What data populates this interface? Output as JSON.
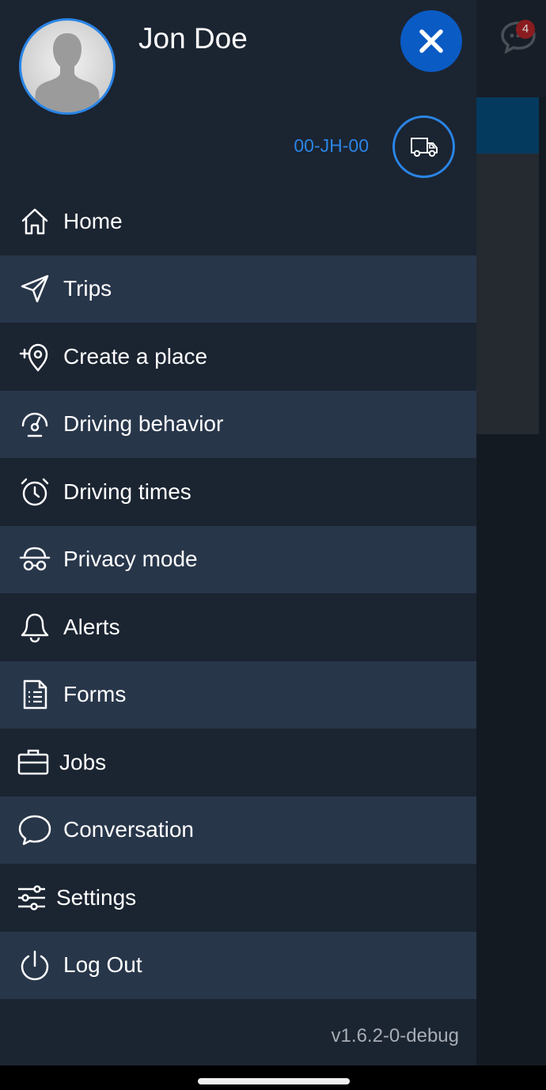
{
  "background": {
    "chat_badge_count": "4"
  },
  "profile": {
    "name": "Jon Doe",
    "vehicle_plate": "00-JH-00"
  },
  "menu": {
    "items": [
      {
        "label": "Home",
        "icon": "home-icon"
      },
      {
        "label": "Trips",
        "icon": "paper-plane-icon"
      },
      {
        "label": "Create a place",
        "icon": "add-place-icon"
      },
      {
        "label": "Driving behavior",
        "icon": "gauge-icon"
      },
      {
        "label": "Driving times",
        "icon": "alarm-clock-icon"
      },
      {
        "label": "Privacy mode",
        "icon": "incognito-icon"
      },
      {
        "label": "Alerts",
        "icon": "bell-icon"
      },
      {
        "label": "Forms",
        "icon": "document-icon"
      },
      {
        "label": "Jobs",
        "icon": "briefcase-icon"
      },
      {
        "label": "Conversation",
        "icon": "chat-bubble-icon"
      },
      {
        "label": "Settings",
        "icon": "sliders-icon"
      },
      {
        "label": "Log Out",
        "icon": "power-icon"
      }
    ]
  },
  "footer": {
    "version": "v1.6.2-0-debug"
  },
  "colors": {
    "drawer_bg": "#1b2431",
    "alt_row_bg": "#28364a",
    "accent": "#2a85e6",
    "close_button": "#0a5bc4"
  }
}
